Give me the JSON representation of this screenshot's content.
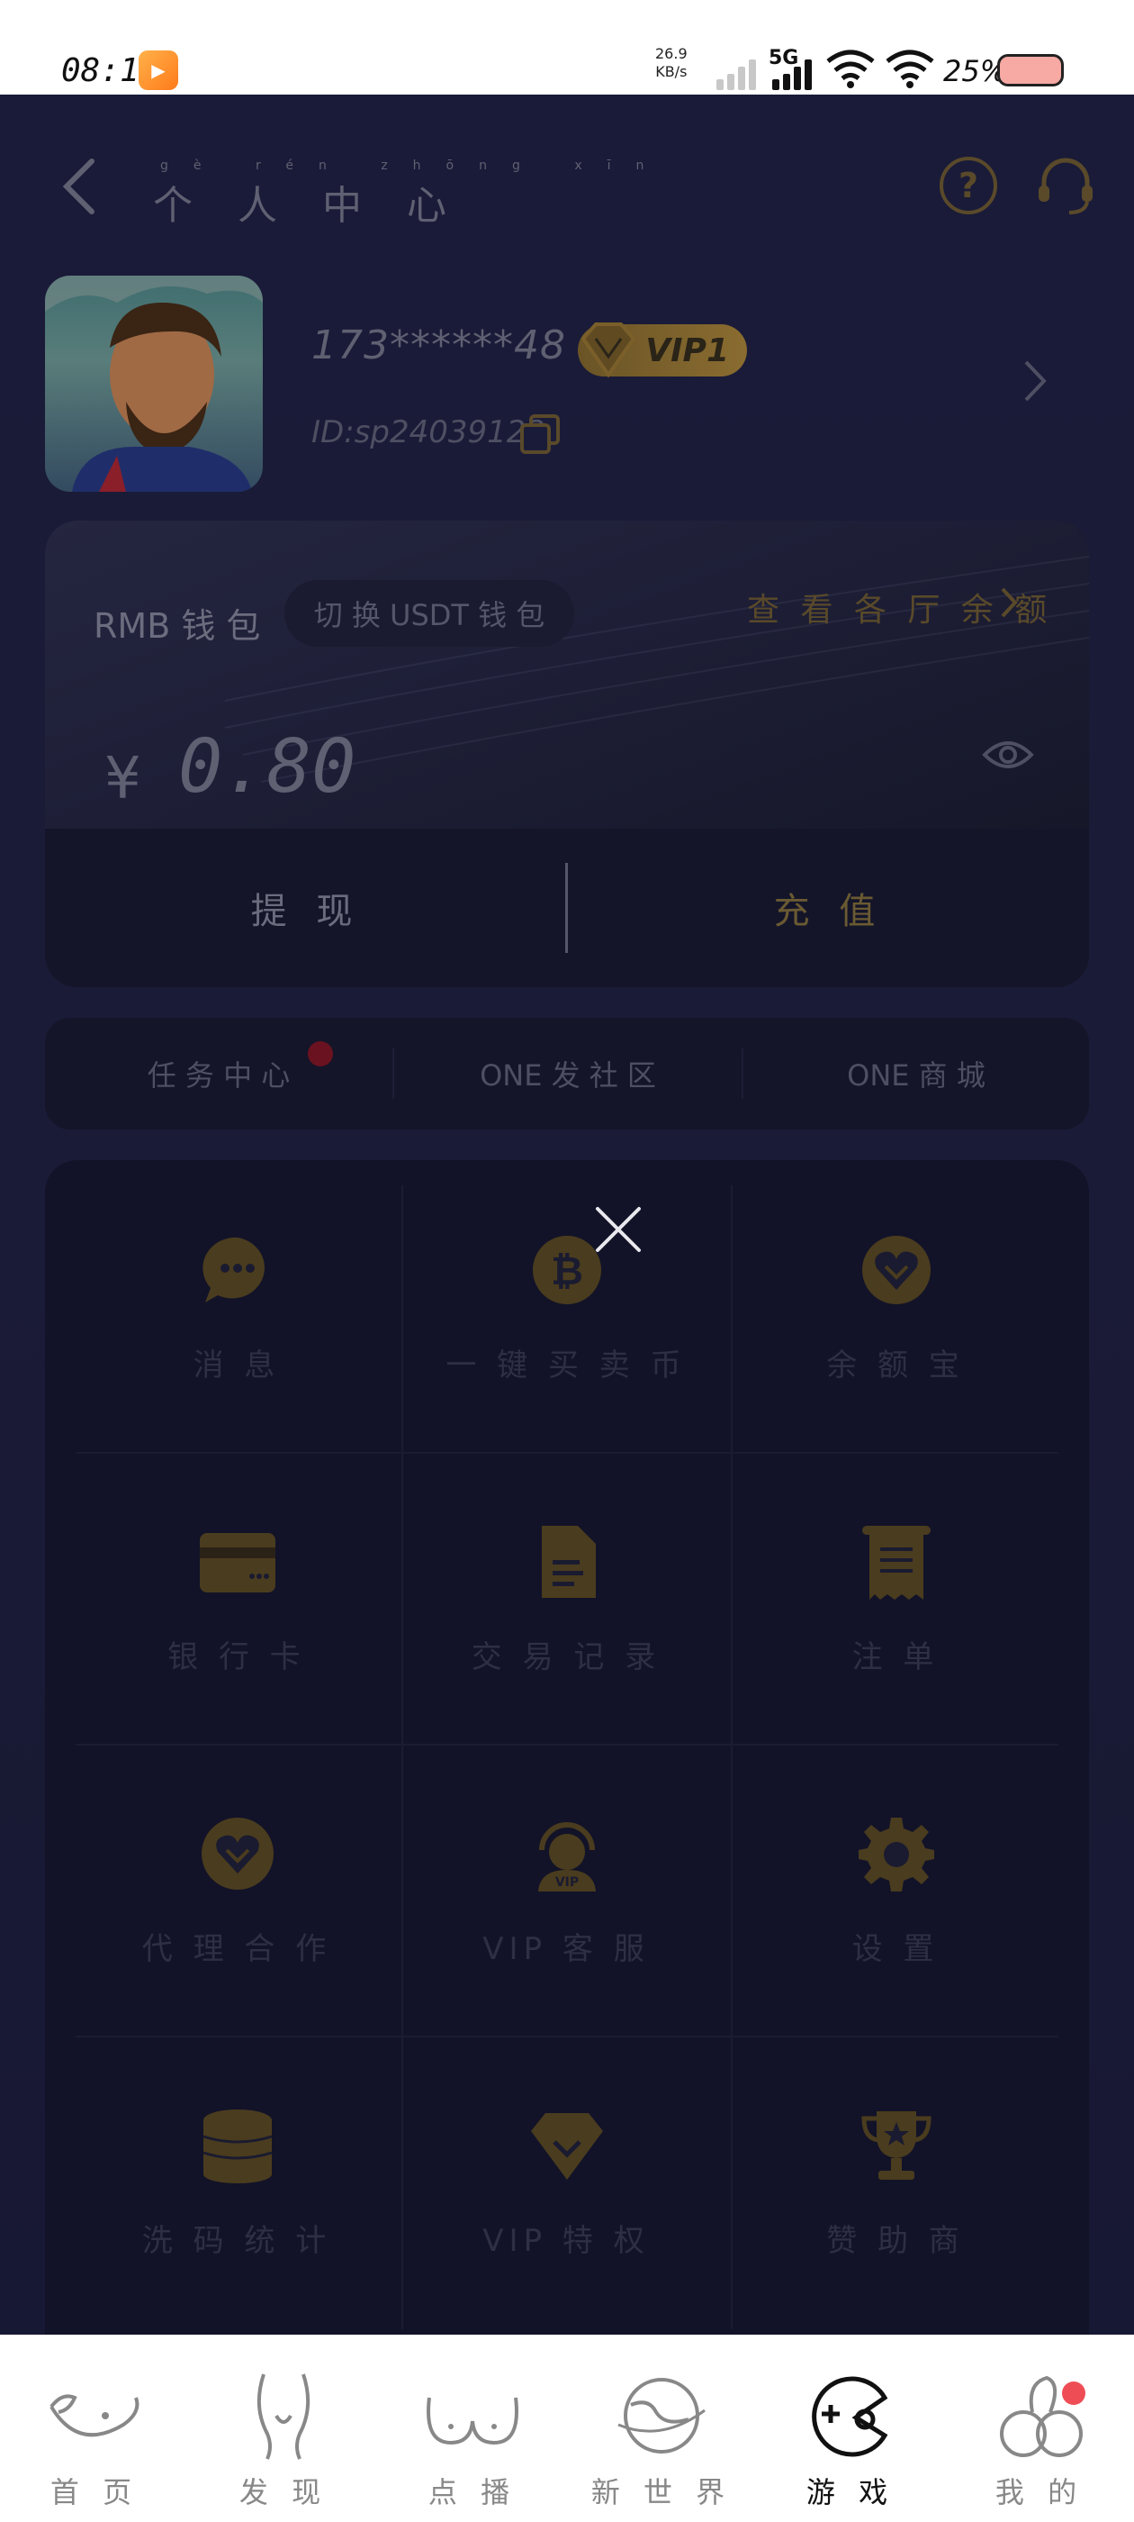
{
  "status_bar": {
    "time": "08:16",
    "net_speed_value": "26.9",
    "net_speed_unit": "KB/s",
    "network": "5G",
    "battery": "25%"
  },
  "header": {
    "title": "个 人 中 心",
    "title_pinyin": "gè rén zhōng xīn",
    "help_icon": "question-circle-icon",
    "service_icon": "headset-icon"
  },
  "profile": {
    "phone": "173******48",
    "vip": "VIP1",
    "user_id": "ID:sp24039122"
  },
  "wallet": {
    "label": "RMB 钱 包",
    "switch_label": "切 换 USDT 钱 包",
    "lobby_link": "查 看 各 厅 余 额",
    "currency": "¥",
    "balance": "0.80",
    "withdraw": "提 现",
    "recharge": "充 值"
  },
  "quick_nav": [
    {
      "label": "任 务 中 心"
    },
    {
      "label": "ONE 发 社 区"
    },
    {
      "label": "ONE 商 城"
    }
  ],
  "grid": [
    {
      "label": "消 息",
      "icon": "chat-icon"
    },
    {
      "label": "一 键 买 卖 币",
      "icon": "bitcoin-icon"
    },
    {
      "label": "余 额 宝",
      "icon": "heart-shield-icon"
    },
    {
      "label": "银 行 卡",
      "icon": "bank-card-icon"
    },
    {
      "label": "交 易 记 录",
      "icon": "document-icon"
    },
    {
      "label": "注 单",
      "icon": "receipt-icon"
    },
    {
      "label": "代 理 合 作",
      "icon": "handshake-icon"
    },
    {
      "label": "VIP 客 服",
      "icon": "vip-agent-icon"
    },
    {
      "label": "设 置",
      "icon": "gear-icon"
    },
    {
      "label": "洗 码 统 计",
      "icon": "coin-stack-icon"
    },
    {
      "label": "VIP 特 权",
      "icon": "vip-diamond-icon"
    },
    {
      "label": "赞 助 商",
      "icon": "trophy-icon"
    }
  ],
  "tabs": [
    {
      "label": "首 页",
      "active": false
    },
    {
      "label": "发 现",
      "active": false
    },
    {
      "label": "点 播",
      "active": false
    },
    {
      "label": "新 世 界",
      "active": false
    },
    {
      "label": "游 戏",
      "active": true
    },
    {
      "label": "我 的",
      "active": false
    }
  ],
  "colors": {
    "background": "#1a1b38",
    "gold_dim": "#5a4a2a",
    "active_tab": "#111111",
    "badge": "#ef4d55"
  }
}
